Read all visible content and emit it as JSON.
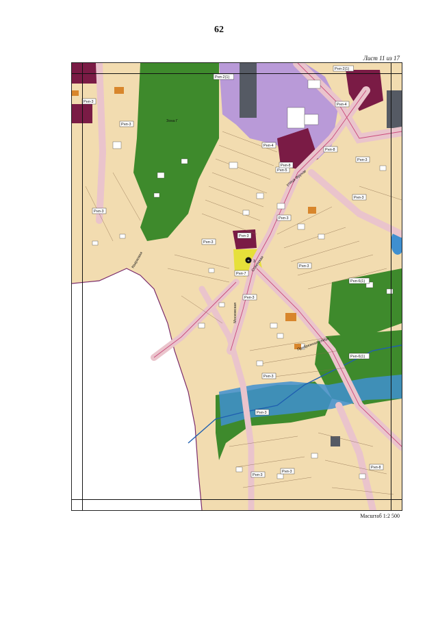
{
  "page": {
    "number": "62",
    "sheet": "Лист 11 из 17",
    "scale": "Масштаб 1:2 500"
  },
  "map": {
    "colors": {
      "residential": "#f2dcb0",
      "green": "#3e8a2c",
      "public": "#b99ad8",
      "commercial": "#7a1b45",
      "roads": "#eac4cc",
      "water": "#3f8fd0",
      "building": "#ffffff",
      "orange": "#d8862c",
      "highlight": "#e6e03a"
    },
    "zone_tags": [
      "Рнп-3",
      "Рнп-2(1)",
      "Рнп-2(1)",
      "Рнп-4",
      "Рнп-3",
      "Рнп-5",
      "Рнп-3",
      "Рнп-3",
      "Рнп-3",
      "Рнп-4",
      "Рнп-7",
      "Рнп-8",
      "Рнп-3",
      "Рнп-3",
      "Рнп-8",
      "Рнп-3",
      "Рнп-3",
      "Рнп-3",
      "Рнп-3",
      "Рнп-6(1)",
      "Рнп-6(1)",
      "Рнп-3",
      "Рнп-8",
      "Рнп-3",
      "Рнп-3"
    ],
    "labels": [
      "Зона Г",
      "3"
    ],
    "streets": [
      "улица Фрунзе",
      "Советская",
      "Московская",
      "Прибрежная улица",
      "Кварковая"
    ]
  }
}
